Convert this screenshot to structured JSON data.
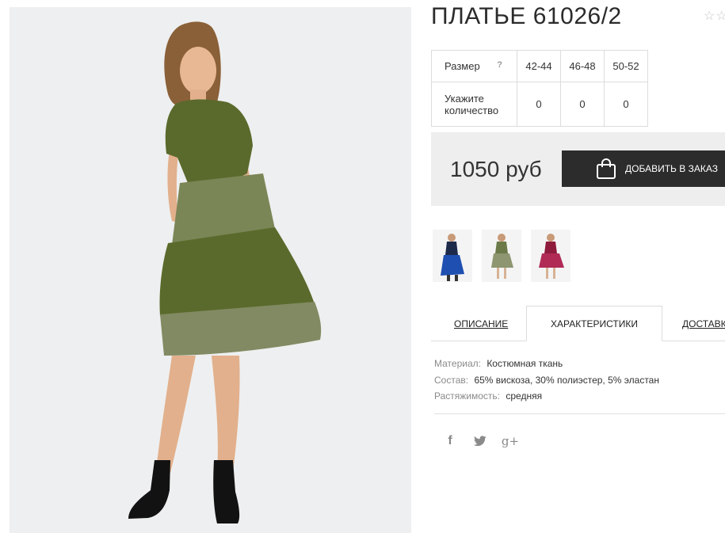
{
  "product": {
    "title": "ПЛАТЬЕ 61026/2",
    "rating_stars": "☆☆"
  },
  "size_table": {
    "size_label": "Размер",
    "help": "?",
    "sizes": [
      "42-44",
      "46-48",
      "50-52"
    ],
    "qty_label": "Укажите количество",
    "quantities": [
      "0",
      "0",
      "0"
    ]
  },
  "purchase": {
    "price": "1050 руб",
    "add_to_cart": "ДОБАВИТЬ В ЗАКАЗ"
  },
  "thumbnails": [
    {
      "name": "navy-blue-dress"
    },
    {
      "name": "olive-dress"
    },
    {
      "name": "burgundy-dress"
    }
  ],
  "tabs": [
    "ОПИСАНИЕ",
    "ХАРАКТЕРИСТИКИ",
    "ДОСТАВКА"
  ],
  "specs": [
    {
      "key": "Материал:",
      "value": "Костюмная ткань"
    },
    {
      "key": "Состав:",
      "value": "65% вискоза, 30% полиэстер, 5% эластан"
    },
    {
      "key": "Растяжимость:",
      "value": "средняя"
    }
  ],
  "social": {
    "facebook": "f",
    "twitter": "twitter-bird",
    "google_plus": "g+"
  },
  "colors": {
    "button_bg": "#2c2c2c",
    "price_box_bg": "#eeeeee",
    "dress_olive": "#5a6a2c"
  }
}
